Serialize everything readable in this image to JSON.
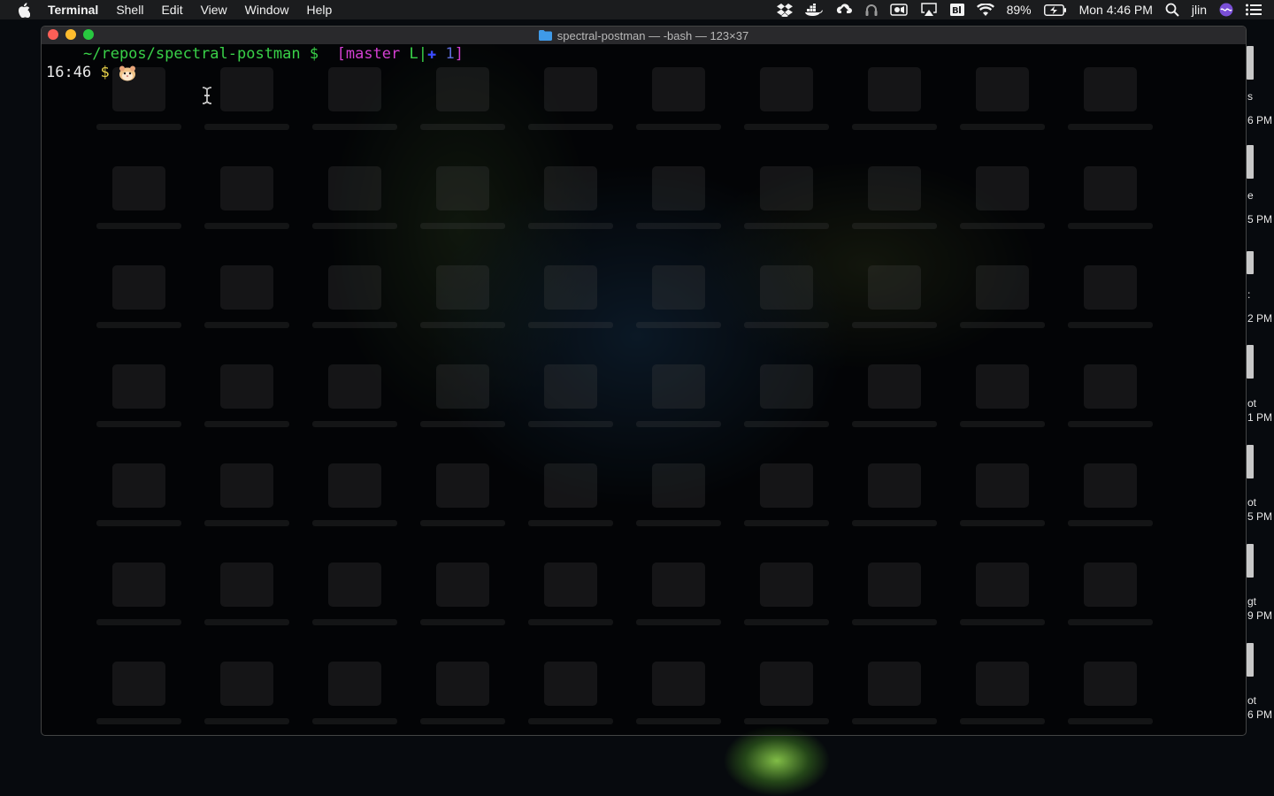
{
  "menubar": {
    "app_name": "Terminal",
    "items": [
      "Shell",
      "Edit",
      "View",
      "Window",
      "Help"
    ],
    "battery": "89%",
    "clock": "Mon 4:46 PM",
    "user": "jlin",
    "icons": [
      "dropbox-icon",
      "docker-icon",
      "cloud-upload-icon",
      "headphones-icon",
      "screen-record-icon",
      "airplay-icon",
      "input-source-icon",
      "wifi-icon",
      "battery-icon",
      "spotlight-icon",
      "siri-icon",
      "notification-center-icon"
    ]
  },
  "window": {
    "title": "spectral-postman — -bash — 123×37"
  },
  "terminal": {
    "line1": {
      "path": "~/repos/spectral-postman $",
      "branch_open": "[",
      "branch": "master",
      "branch_sep": " L|",
      "plus": "✚",
      "count": " 1",
      "branch_close": "]"
    },
    "line2": {
      "time": "16:46",
      "prompt": "$"
    }
  },
  "desktop_edge_labels": [
    {
      "top_text": "s",
      "bottom_text": "6 PM"
    },
    {
      "top_text": "e",
      "bottom_text": "5 PM"
    },
    {
      "top_text": ":",
      "bottom_text": "2 PM"
    },
    {
      "top_text": "ot",
      "bottom_text": "1 PM"
    },
    {
      "top_text": "ot",
      "bottom_text": "5 PM"
    },
    {
      "top_text": "gt",
      "bottom_text": "9 PM"
    },
    {
      "top_text": "ot",
      "bottom_text": "6 PM"
    }
  ],
  "colors": {
    "prompt_green": "#39d148",
    "branch_magenta": "#d33fd1",
    "plus_blue": "#3a4bff",
    "time_white": "#e9e9e9",
    "dollar_yellow": "#e9d24a"
  }
}
